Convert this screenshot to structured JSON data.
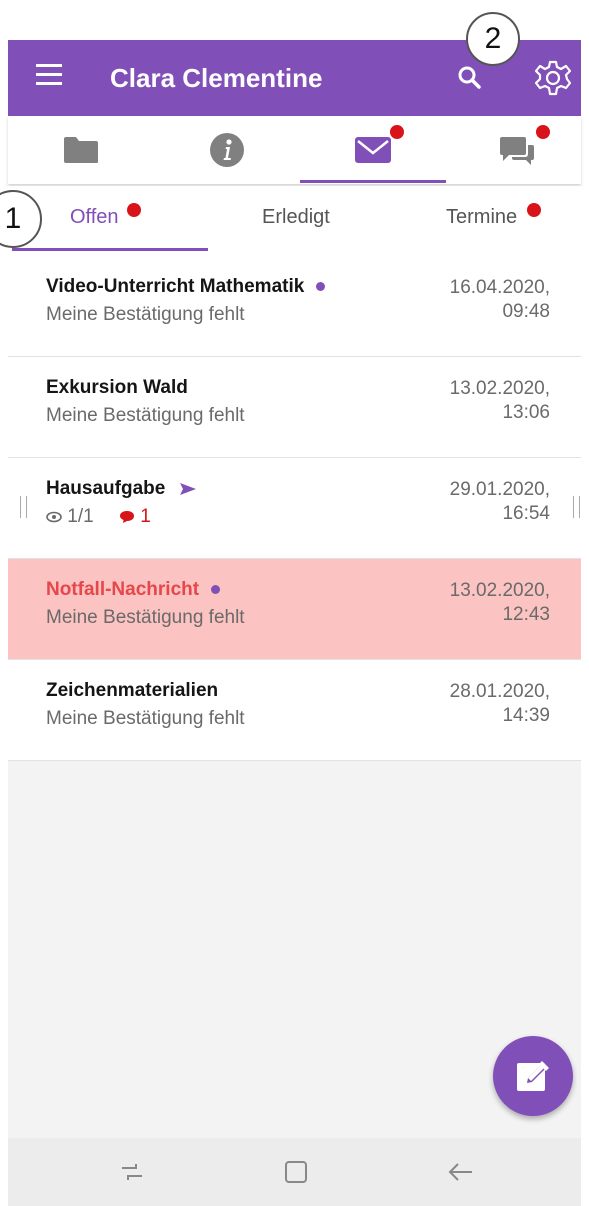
{
  "header": {
    "menu_icon": "hamburger-menu-icon",
    "title": "Clara Clementine",
    "search_icon": "search-icon",
    "settings_icon": "gear-icon",
    "background": "#804fb8"
  },
  "callouts": [
    "1",
    "2"
  ],
  "categories": [
    {
      "icon": "folder-icon",
      "badge": false
    },
    {
      "icon": "info-icon",
      "badge": false
    },
    {
      "icon": "mail-icon",
      "badge": true,
      "active": true
    },
    {
      "icon": "chat-icon",
      "badge": true
    }
  ],
  "tabs": [
    {
      "label": "Offen",
      "badge": true,
      "active": true
    },
    {
      "label": "Erledigt",
      "badge": false
    },
    {
      "label": "Termine",
      "badge": true
    }
  ],
  "messages": [
    {
      "title": "Video-Unterricht Mathematik",
      "subtitle": "Meine Bestätigung fehlt",
      "date": "16.04.2020,",
      "time": "09:48",
      "unread_dot": true
    },
    {
      "title": "Exkursion Wald",
      "subtitle": "Meine Bestätigung fehlt",
      "date": "13.02.2020,",
      "time": "13:06",
      "unread_dot": false
    },
    {
      "title": "Hausaufgabe",
      "views": "1/1",
      "comments": "1",
      "date": "29.01.2020,",
      "time": "16:54",
      "sent_icon": "send-icon"
    },
    {
      "title": "Notfall-Nachricht",
      "subtitle": "Meine Bestätigung fehlt",
      "date": "13.02.2020,",
      "time": "12:43",
      "unread_dot": true,
      "emergency": true
    },
    {
      "title": "Zeichenmaterialien",
      "subtitle": "Meine Bestätigung fehlt",
      "date": "28.01.2020,",
      "time": "14:39",
      "unread_dot": false
    }
  ],
  "fab": {
    "icon": "compose-icon"
  },
  "navbar": {
    "icons": [
      "recent-apps-icon",
      "home-icon",
      "back-icon"
    ]
  },
  "colors": {
    "accent": "#804fb8",
    "badge": "#d81319",
    "emergency_bg": "#fbc3c1",
    "emergency_text": "#e5474b"
  }
}
